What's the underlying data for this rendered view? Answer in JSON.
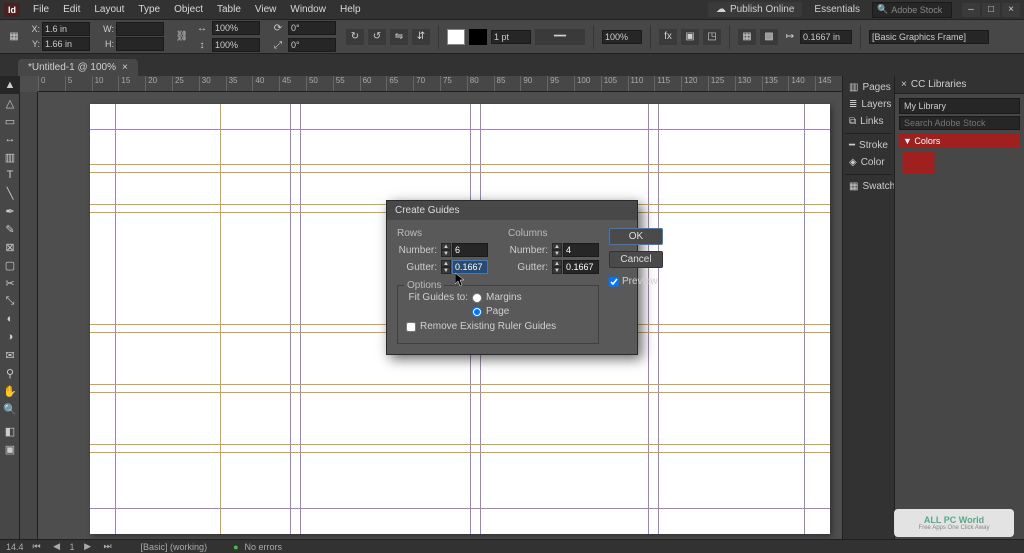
{
  "app": {
    "icon_label": "Id"
  },
  "menu": {
    "items": [
      "File",
      "Edit",
      "Layout",
      "Type",
      "Object",
      "Table",
      "View",
      "Window",
      "Help"
    ]
  },
  "menubar_right": {
    "publish": "Publish Online",
    "workspace": "Essentials",
    "search_placeholder": "Adobe Stock"
  },
  "window_controls": {
    "min": "–",
    "max": "□",
    "close": "×"
  },
  "controlbar": {
    "x": "1.6 in",
    "y": "1.66 in",
    "w": "",
    "h": "",
    "rotation": "0°",
    "shear": "0°",
    "zoom": "100%",
    "zoom2": "100%",
    "stroke_weight": "1 pt",
    "xoff": "0.1667 in",
    "frame_preset": "[Basic Graphics Frame]"
  },
  "doctab": {
    "title": "*Untitled-1 @ 100%",
    "close": "×"
  },
  "ruler_ticks": [
    "0",
    "5",
    "10",
    "15",
    "20",
    "25",
    "30",
    "35",
    "40",
    "45",
    "50",
    "55",
    "60",
    "65",
    "70",
    "75",
    "80",
    "85",
    "90",
    "95",
    "100",
    "105",
    "110",
    "115",
    "120",
    "125",
    "130",
    "135",
    "140",
    "145"
  ],
  "right_strip": {
    "pages": "Pages",
    "layers": "Layers",
    "links": "Links",
    "stroke": "Stroke",
    "color": "Color",
    "swatches": "Swatches"
  },
  "right_panels": {
    "cc_tab": "CC Libraries",
    "lib_select": "My Library",
    "lib_search_placeholder": "Search Adobe Stock",
    "colors_header": "▼ Colors"
  },
  "dialog": {
    "title": "Create Guides",
    "rows_heading": "Rows",
    "columns_heading": "Columns",
    "number_label": "Number:",
    "gutter_label": "Gutter:",
    "rows_number": "6",
    "rows_gutter": "0.1667 in",
    "cols_number": "4",
    "cols_gutter": "0.1667 in",
    "options_heading": "Options",
    "fit_label": "Fit Guides to:",
    "fit_margins": "Margins",
    "fit_page": "Page",
    "remove_label": "Remove Existing Ruler Guides",
    "ok": "OK",
    "cancel": "Cancel",
    "preview": "Preview"
  },
  "status": {
    "zoom": "14.4",
    "page": "1",
    "preset": "[Basic] (working)",
    "errors": "No errors"
  },
  "watermark": {
    "title": "ALL PC World",
    "sub": "Free Apps One Click Away"
  }
}
